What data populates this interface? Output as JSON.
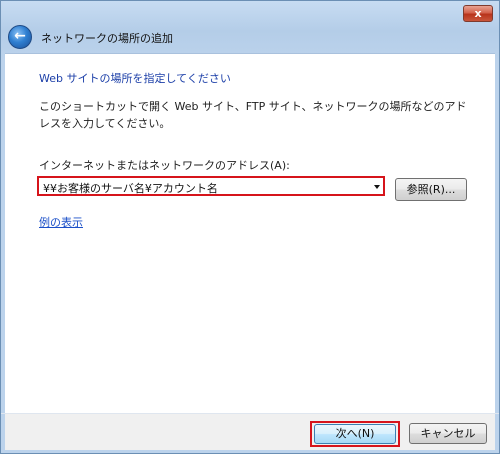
{
  "window": {
    "close_label": "x",
    "back_glyph": "←",
    "title": "ネットワークの場所の追加"
  },
  "page": {
    "heading": "Web サイトの場所を指定してください",
    "description": "このショートカットで開く Web サイト、FTP サイト、ネットワークの場所などのアドレスを入力してください。",
    "address_label": "インターネットまたはネットワークのアドレス(A):",
    "address_value": "¥¥お客様のサーバ名¥アカウント名",
    "browse_label": "参照(R)...",
    "example_link": "例の表示"
  },
  "footer": {
    "next_label": "次へ(N)",
    "cancel_label": "キャンセル"
  },
  "colors": {
    "highlight": "#d6141b",
    "heading": "#1c3fa8",
    "link": "#1c50c8"
  },
  "icons": {
    "back": "back-arrow-icon",
    "close": "close-icon",
    "dropdown": "chevron-down-icon"
  }
}
